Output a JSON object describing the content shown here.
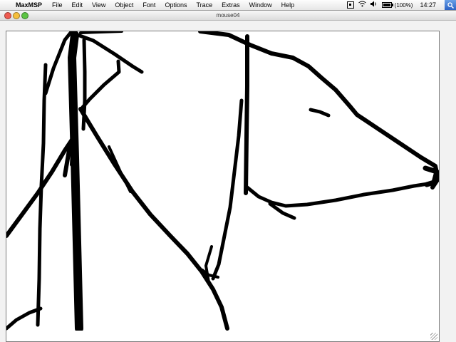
{
  "menubar": {
    "apple_glyph": "",
    "app_name": "MaxMSP",
    "items": [
      "File",
      "Edit",
      "View",
      "Object",
      "Font",
      "Options",
      "Trace",
      "Extras",
      "Window",
      "Help"
    ],
    "status": {
      "battery_text": "(100%)",
      "battery_level": 1.0,
      "clock": "14:27",
      "icons": [
        "menu-extra-icon",
        "wifi-icon",
        "volume-icon",
        "battery-icon",
        "spotlight-icon"
      ]
    }
  },
  "window": {
    "title": "mouse04",
    "colors": {
      "close": "#ee5a50",
      "minimize": "#f5be3c",
      "zoom": "#5cc444"
    }
  },
  "canvas": {
    "background": "#ffffff",
    "stroke_color": "#000000",
    "content": "freehand black line drawing"
  }
}
